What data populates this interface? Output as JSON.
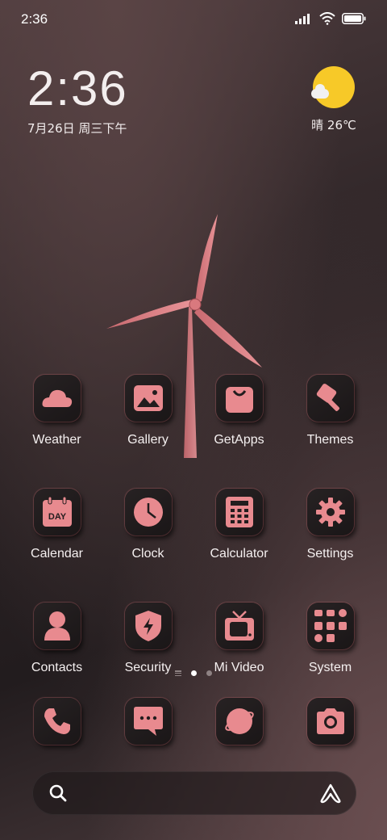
{
  "status": {
    "time": "2:36"
  },
  "clock": {
    "time": "2:36",
    "date": "7月26日 周三下午"
  },
  "weather": {
    "text": "晴 26℃"
  },
  "apps": [
    [
      {
        "label": "Weather"
      },
      {
        "label": "Gallery"
      },
      {
        "label": "GetApps"
      },
      {
        "label": "Themes"
      }
    ],
    [
      {
        "label": "Calendar"
      },
      {
        "label": "Clock"
      },
      {
        "label": "Calculator"
      },
      {
        "label": "Settings"
      }
    ],
    [
      {
        "label": "Contacts"
      },
      {
        "label": "Security"
      },
      {
        "label": "Mi Video"
      },
      {
        "label": "System"
      }
    ]
  ],
  "calendar_icon_text": "DAY",
  "colors": {
    "accent": "#e88a8f",
    "icon_bg": "#221d1e",
    "sun": "#f7c928"
  }
}
